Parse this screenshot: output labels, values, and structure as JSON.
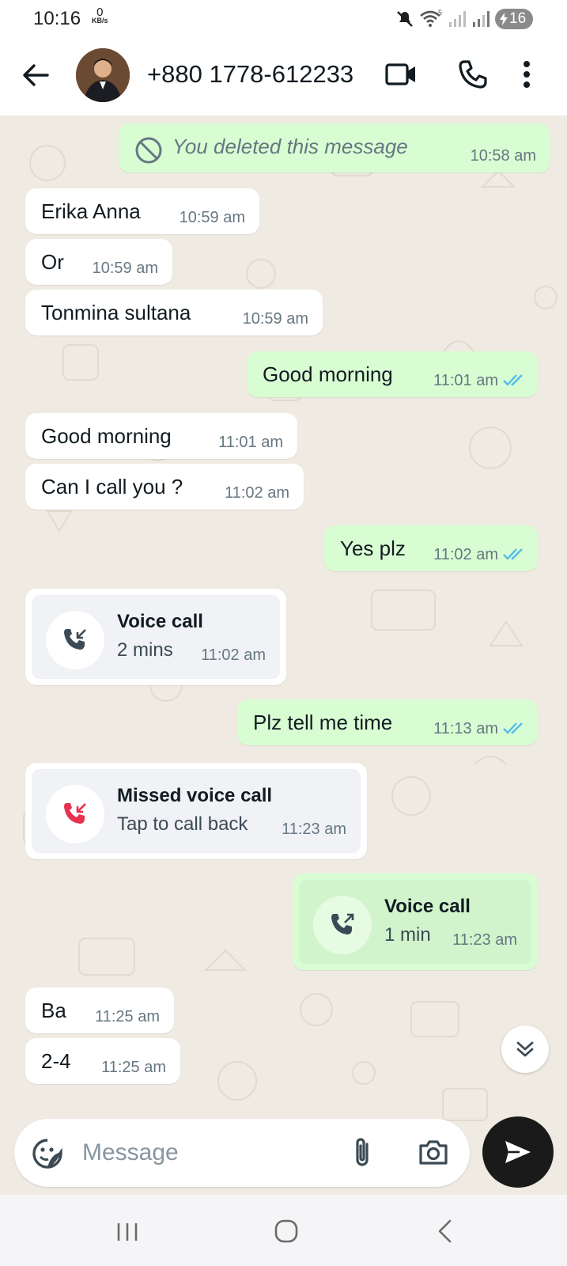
{
  "status_bar": {
    "time": "10:16",
    "net_speed_value": "0",
    "net_speed_unit": "KB/s",
    "battery": "16",
    "icons": [
      "mute-icon",
      "wifi-icon",
      "signal-icon",
      "signal-icon",
      "battery-charging-icon"
    ]
  },
  "header": {
    "contact_name": "+880 1778-612233",
    "icons": [
      "back-arrow-icon",
      "avatar",
      "video-call-icon",
      "phone-icon",
      "more-vert-icon"
    ]
  },
  "messages": [
    {
      "dir": "out",
      "type": "deleted",
      "text": "You deleted this message",
      "time": "10:58 am"
    },
    {
      "dir": "in",
      "text": "Erika Anna",
      "time": "10:59 am"
    },
    {
      "dir": "in",
      "text": "Or",
      "time": "10:59 am"
    },
    {
      "dir": "in",
      "text": "Tonmina sultana",
      "time": "10:59 am"
    },
    {
      "dir": "out",
      "text": "Good morning",
      "time": "11:01 am",
      "status": "read"
    },
    {
      "dir": "in",
      "text": "Good morning",
      "time": "11:01 am"
    },
    {
      "dir": "in",
      "text": "Can I call you ?",
      "time": "11:02 am"
    },
    {
      "dir": "out",
      "text": "Yes plz",
      "time": "11:02 am",
      "status": "read"
    },
    {
      "dir": "in",
      "type": "call",
      "title": "Voice call",
      "subtitle": "2 mins",
      "time": "11:02 am",
      "call_icon": "incoming-call-icon"
    },
    {
      "dir": "out",
      "text": "Plz tell me time",
      "time": "11:13 am",
      "status": "read"
    },
    {
      "dir": "in",
      "type": "missed-call",
      "title": "Missed voice call",
      "subtitle": "Tap to call back",
      "time": "11:23 am",
      "call_icon": "missed-call-icon"
    },
    {
      "dir": "out",
      "type": "call",
      "title": "Voice call",
      "subtitle": "1 min",
      "time": "11:23 am",
      "call_icon": "outgoing-call-icon"
    },
    {
      "dir": "in",
      "text": "Ba",
      "time": "11:25 am"
    },
    {
      "dir": "in",
      "text": "2-4",
      "time": "11:25 am"
    }
  ],
  "composer": {
    "placeholder": "Message",
    "icons": [
      "emoji-icon",
      "attach-icon",
      "camera-icon",
      "send-icon"
    ]
  },
  "colors": {
    "chat_background": "#efeae2",
    "incoming_bubble": "#ffffff",
    "outgoing_bubble": "#d9fdd3",
    "read_tick": "#53bdeb",
    "missed_call": "#e8304f",
    "send_button": "#1a1a1a"
  },
  "nav_bar": {
    "icons": [
      "recent-apps-icon",
      "home-icon",
      "nav-back-icon"
    ]
  }
}
